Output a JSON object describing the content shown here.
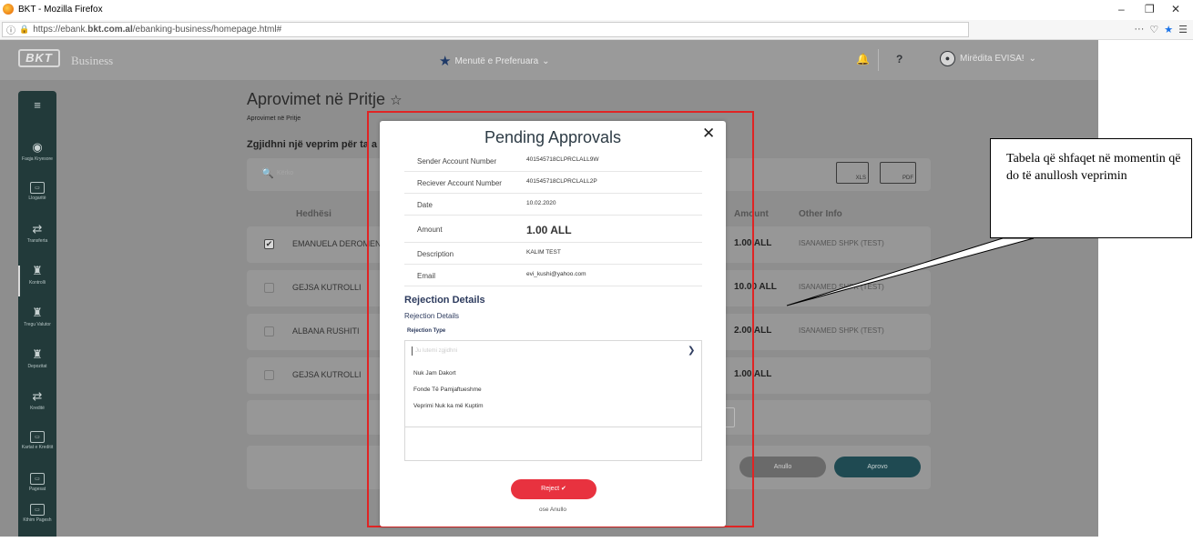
{
  "browser": {
    "window_title": "BKT - Mozilla Firefox",
    "url_prefix": "https://ebank.",
    "url_domain": "bkt.com.al",
    "url_suffix": "/ebanking-business/homepage.html#",
    "toolbar_more": "···",
    "window_controls": [
      "–",
      "❐",
      "✕"
    ]
  },
  "header": {
    "logo_text": "BKT",
    "app_name": "Business",
    "favorites_menu": "Menutë e Preferuara",
    "user_name": "Mirëdita EVISA!"
  },
  "sidebar": {
    "items": [
      {
        "label": "",
        "icon": "menu-icon"
      },
      {
        "label": "Faqja Kryesore",
        "icon": "home-icon"
      },
      {
        "label": "Llogaritë",
        "icon": "account-icon"
      },
      {
        "label": "Transferta",
        "icon": "transfer-icon"
      },
      {
        "label": "Kontrolli",
        "icon": "stamp-icon"
      },
      {
        "label": "Tregu Valutor",
        "icon": "stamp-icon"
      },
      {
        "label": "Depozitat",
        "icon": "stamp-icon"
      },
      {
        "label": "Kreditë",
        "icon": "transfer-icon"
      },
      {
        "label": "Kartat e Kreditit",
        "icon": "account-icon"
      },
      {
        "label": "Pagesat",
        "icon": "account-icon"
      },
      {
        "label": "Kthim Pagesh",
        "icon": "account-icon"
      }
    ]
  },
  "page": {
    "title": "Aprovimet në Pritje",
    "subtitle": "Aprovimet në Pritje",
    "hint": "Zgjidhni një veprim për ta a",
    "search_placeholder": "Kërko",
    "export_xls": "XLS",
    "export_pdf": "PDF",
    "col_sender": "Hedhësi",
    "col_amount": "Amount",
    "col_other": "Other Info",
    "rows": [
      {
        "name": "EMANUELA DEROMEN",
        "amount": "1.00 ALL",
        "info": "ISANAMED SHPK (TEST)",
        "checked": true
      },
      {
        "name": "GEJSA KUTROLLI",
        "amount": "10.00 ALL",
        "info": "ISANAMED SHPK (TEST)",
        "checked": false
      },
      {
        "name": "ALBANA RUSHITI",
        "amount": "2.00 ALL",
        "info": "ISANAMED SHPK (TEST)",
        "checked": false
      },
      {
        "name": "GEJSA KUTROLLI",
        "amount": "1.00 ALL",
        "info": "",
        "checked": false
      }
    ],
    "cancel_button": "Anullo",
    "approve_button": "Aprovo"
  },
  "modal": {
    "title": "Pending Approvals",
    "details": [
      {
        "key": "Sender Account Number",
        "value": "401545718CLPRCLALL9W"
      },
      {
        "key": "Reciever Account Number",
        "value": "401545718CLPRCLALL2P"
      },
      {
        "key": "Date",
        "value": "10.02.2020"
      },
      {
        "key": "Amount",
        "value": "1.00 ALL"
      },
      {
        "key": "Description",
        "value": "KALIM TEST"
      },
      {
        "key": "Email",
        "value": "evi_kushi@yahoo.com"
      }
    ],
    "rejection_heading": "Rejection Details",
    "rejection_sub": "Rejection Details",
    "rejection_type_label": "Rejection Type",
    "rejection_placeholder": "Ju lutemi zgjidhni",
    "options": [
      "Nuk Jam Dakort",
      "Fonde Të Pamjaftueshme",
      "Veprimi Nuk ka më Kuptim"
    ],
    "reject_button": "Reject ✔",
    "or_cancel": "ose Anullo"
  },
  "annotation": {
    "text": "Tabela që shfaqet në momentin që do të anullosh veprimin"
  },
  "colors": {
    "sidebar": "#223a3a",
    "reject": "#e8323f",
    "highlight_frame": "#e02424",
    "approve": "#1f4a52"
  }
}
